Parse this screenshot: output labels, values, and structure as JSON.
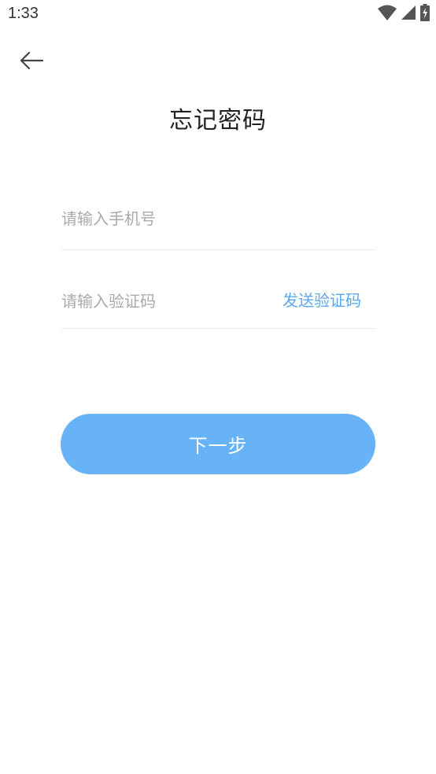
{
  "status_bar": {
    "time": "1:33",
    "icons": [
      "wifi-icon",
      "signal-icon",
      "battery-charging-icon"
    ]
  },
  "header": {
    "back_icon": "arrow-left-icon",
    "title": "忘记密码"
  },
  "form": {
    "phone_placeholder": "请输入手机号",
    "code_placeholder": "请输入验证码",
    "send_code_label": "发送验证码",
    "next_label": "下一步"
  },
  "colors": {
    "accent": "#5aa8ee",
    "button_bg": "#68b2f8",
    "divider": "#ececec",
    "placeholder": "#aaaaaa"
  }
}
